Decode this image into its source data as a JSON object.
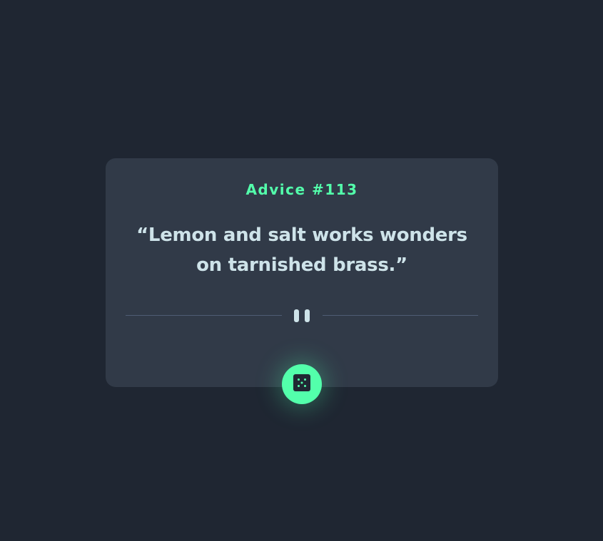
{
  "card": {
    "advice_label": "Advice #113",
    "quote": "“Lemon and salt works wonders on tarnished brass.”"
  },
  "divider": {
    "icon": "pause-icon"
  },
  "button": {
    "icon": "dice-icon",
    "aria_label": "Get new advice"
  },
  "colors": {
    "background": "#1f2632",
    "card": "#313a48",
    "accent": "#53ffab",
    "text": "#cee3e9",
    "divider": "#4f5d74"
  }
}
